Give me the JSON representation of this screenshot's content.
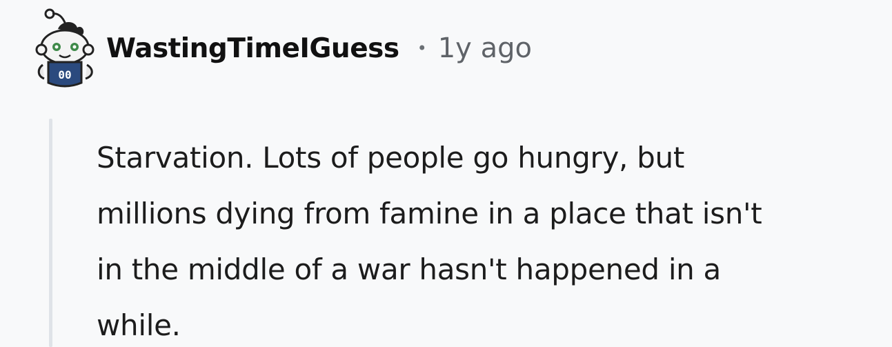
{
  "comment": {
    "author": "WastingTimeIGuess",
    "separator": "•",
    "timestamp": "1y ago",
    "body_lines": [
      "Starvation. Lots of people go hungry, but",
      "millions dying from famine in a place that isn't",
      "in the middle of a war hasn't happened in a",
      "while."
    ],
    "avatar": {
      "icon": "snoo-avatar-icon",
      "jersey_number": "00",
      "colors": {
        "jersey": "#2b4a7e",
        "eyes": "#3f8a4a",
        "outline": "#222222"
      }
    }
  }
}
